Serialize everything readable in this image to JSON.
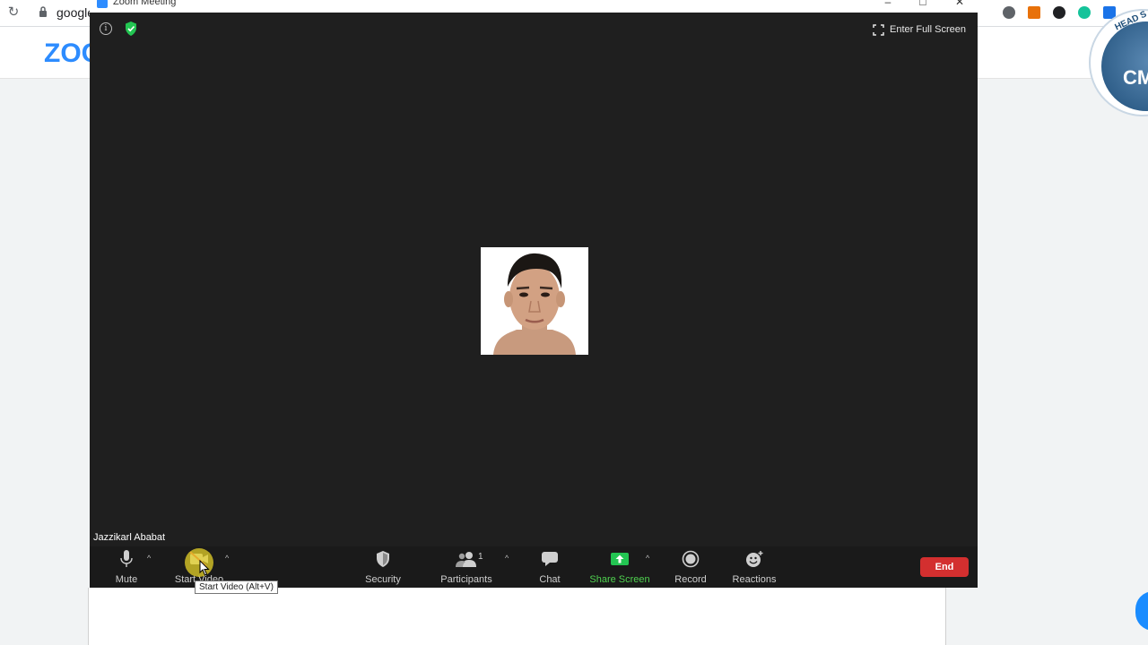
{
  "browser": {
    "url_fragment": "google",
    "site_logo": "ZOO"
  },
  "window": {
    "title": "Zoom Meeting"
  },
  "meeting": {
    "enter_full_screen": "Enter Full Screen",
    "participant_name": "Jazzikarl Ababat",
    "info_icon_glyph": "i"
  },
  "toolbar": {
    "mute": "Mute",
    "start_video": "Start Video",
    "security": "Security",
    "participants": "Participants",
    "participants_count": "1",
    "chat": "Chat",
    "share_screen": "Share Screen",
    "record": "Record",
    "reactions": "Reactions",
    "end": "End"
  },
  "tooltip": {
    "text": "Start Video (Alt+V)"
  },
  "badge": {
    "top_text": "HEAD S",
    "main_text": "CM"
  },
  "colors": {
    "stage_bg": "#1f1f1f",
    "toolbar_bg": "#1a1a1a",
    "share_green": "#4fd14f",
    "end_red": "#d32f2f",
    "zoom_blue": "#2d8cff"
  }
}
